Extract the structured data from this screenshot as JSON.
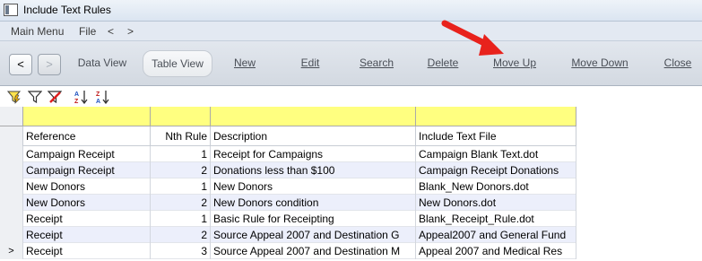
{
  "window": {
    "title": "Include Text Rules"
  },
  "menubar": {
    "items": [
      "Main Menu",
      "File",
      "<",
      ">"
    ]
  },
  "toolbar": {
    "back_label": "<",
    "forward_label": ">",
    "buttons": [
      {
        "label": "Data View",
        "underline": ""
      },
      {
        "label": "Table View",
        "underline": ""
      },
      {
        "label": "New",
        "underline": "N"
      },
      {
        "label": "Edit",
        "underline": "E"
      },
      {
        "label": "Search",
        "underline": "S"
      },
      {
        "label": "Delete",
        "underline": "D"
      },
      {
        "label": "Move Up",
        "underline": "U"
      },
      {
        "label": "Move Down",
        "underline": "w"
      },
      {
        "label": "Close",
        "underline": "C"
      }
    ]
  },
  "filter_icons": [
    "filter-lightning-icon",
    "filter-icon",
    "filter-clear-icon",
    "sort-ascending-icon",
    "sort-descending-icon"
  ],
  "grid": {
    "columns": [
      "Reference",
      "Nth Rule",
      "Description",
      "Include Text File"
    ],
    "rows": [
      {
        "selector": "",
        "reference": "Campaign Receipt",
        "nth": "1",
        "description": "Receipt for Campaigns",
        "file": "Campaign Blank Text.dot"
      },
      {
        "selector": "",
        "reference": "Campaign Receipt",
        "nth": "2",
        "description": "Donations less than $100",
        "file": "Campaign Receipt Donations"
      },
      {
        "selector": "",
        "reference": "New Donors",
        "nth": "1",
        "description": "New Donors",
        "file": "Blank_New Donors.dot"
      },
      {
        "selector": "",
        "reference": "New Donors",
        "nth": "2",
        "description": "New Donors condition",
        "file": "New Donors.dot"
      },
      {
        "selector": "",
        "reference": "Receipt",
        "nth": "1",
        "description": "Basic Rule for Receipting",
        "file": "Blank_Receipt_Rule.dot"
      },
      {
        "selector": "",
        "reference": "Receipt",
        "nth": "2",
        "description": "Source Appeal 2007 and Destination G",
        "file": "Appeal2007 and General Fund"
      },
      {
        "selector": ">",
        "reference": "Receipt",
        "nth": "3",
        "description": "Source Appeal 2007 and Destination M",
        "file": "Appeal 2007 and Medical Res"
      }
    ]
  },
  "colors": {
    "filter_row": "#ffff80",
    "annotation_arrow": "#e8221c",
    "row_alt": "#eceffb"
  }
}
